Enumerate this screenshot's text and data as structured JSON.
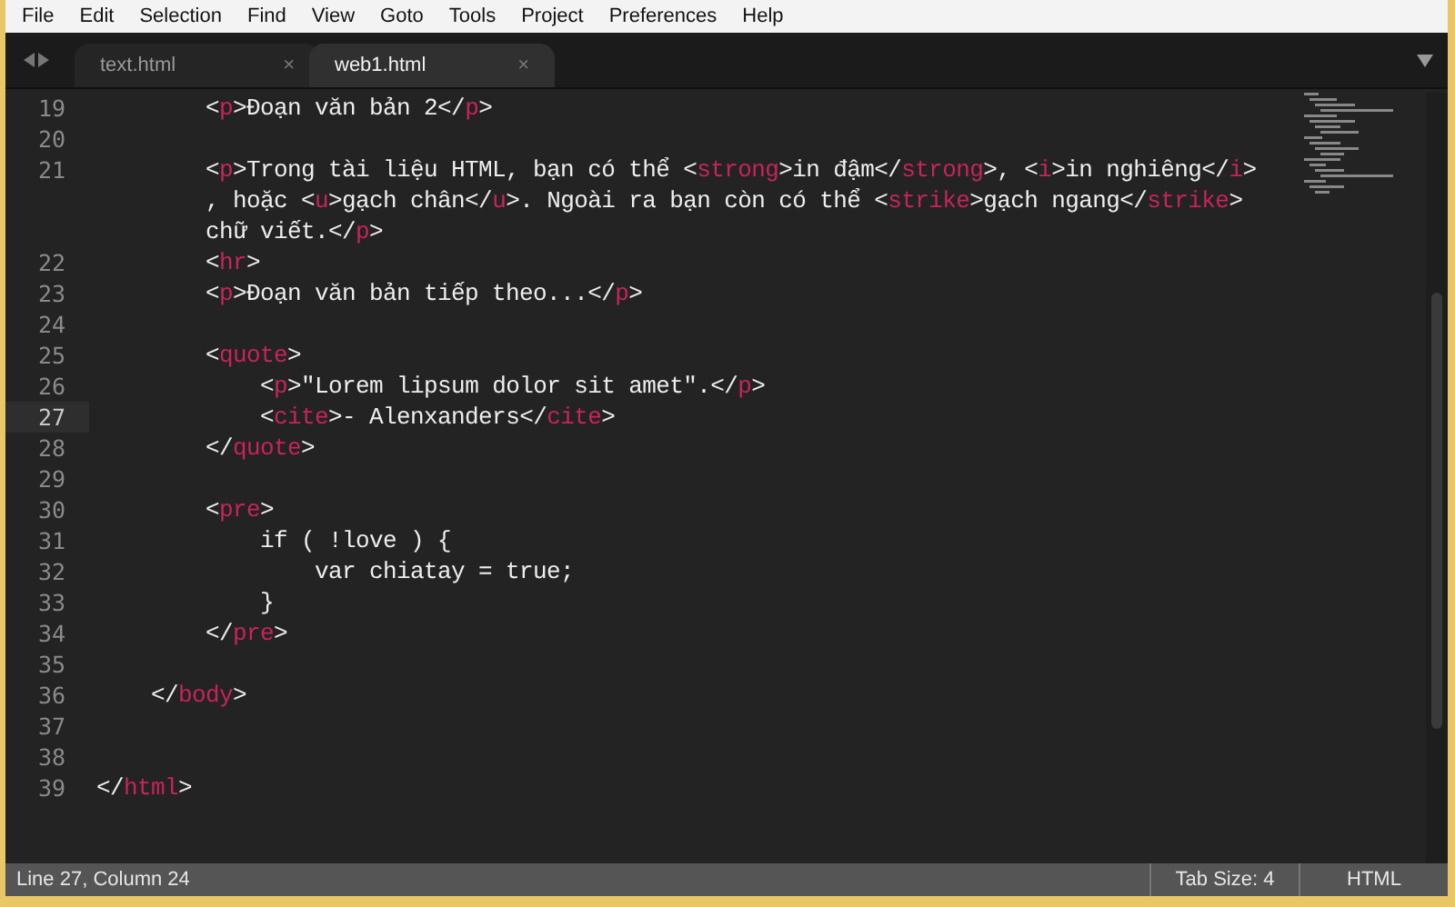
{
  "menu": [
    "File",
    "Edit",
    "Selection",
    "Find",
    "View",
    "Goto",
    "Tools",
    "Project",
    "Preferences",
    "Help"
  ],
  "tabs": [
    {
      "label": "text.html",
      "close": "×",
      "selected": false
    },
    {
      "label": "web1.html",
      "close": "×",
      "selected": true
    }
  ],
  "lines": [
    {
      "number": "19",
      "selected": false,
      "rows": [
        {
          "tokens": [
            {
              "kind": "text",
              "text": "        <"
            },
            {
              "kind": "tag",
              "text": "p"
            },
            {
              "kind": "text",
              "text": ">Đoạn văn bản 2</"
            },
            {
              "kind": "tag",
              "text": "p"
            },
            {
              "kind": "text",
              "text": ">"
            }
          ]
        }
      ]
    },
    {
      "number": "20",
      "selected": false
    },
    {
      "number": "21",
      "selected": false,
      "rows": [
        {
          "tokens": [
            {
              "kind": "text",
              "text": "        <"
            },
            {
              "kind": "tag",
              "text": "p"
            },
            {
              "kind": "text",
              "text": ">Trong tài liệu HTML, bạn có thể <"
            },
            {
              "kind": "tag",
              "text": "strong"
            },
            {
              "kind": "text",
              "text": ">in đậm</"
            },
            {
              "kind": "tag",
              "text": "strong"
            },
            {
              "kind": "text",
              "text": ">, <"
            },
            {
              "kind": "tag",
              "text": "i"
            },
            {
              "kind": "text",
              "text": ">in nghiêng</"
            },
            {
              "kind": "tag",
              "text": "i"
            },
            {
              "kind": "text",
              "text": ">"
            }
          ]
        },
        {
          "tokens": [
            {
              "kind": "text",
              "text": "        , hoặc <"
            },
            {
              "kind": "tag",
              "text": "u"
            },
            {
              "kind": "text",
              "text": ">gạch chân</"
            },
            {
              "kind": "tag",
              "text": "u"
            },
            {
              "kind": "text",
              "text": ">. Ngoài ra bạn còn có thể <"
            },
            {
              "kind": "tag",
              "text": "strike"
            },
            {
              "kind": "text",
              "text": ">gạch ngang</"
            },
            {
              "kind": "tag",
              "text": "strike"
            },
            {
              "kind": "text",
              "text": ">"
            }
          ]
        },
        {
          "tokens": [
            {
              "kind": "text",
              "text": "        chữ viết.</"
            },
            {
              "kind": "tag",
              "text": "p"
            },
            {
              "kind": "text",
              "text": ">"
            }
          ]
        }
      ]
    },
    {
      "number": "22",
      "selected": false,
      "rows": [
        {
          "tokens": [
            {
              "kind": "text",
              "text": "        <"
            },
            {
              "kind": "tag",
              "text": "hr"
            },
            {
              "kind": "text",
              "text": ">"
            }
          ]
        }
      ]
    },
    {
      "number": "23",
      "selected": false,
      "rows": [
        {
          "tokens": [
            {
              "kind": "text",
              "text": "        <"
            },
            {
              "kind": "tag",
              "text": "p"
            },
            {
              "kind": "text",
              "text": ">Đoạn văn bản tiếp theo...</"
            },
            {
              "kind": "tag",
              "text": "p"
            },
            {
              "kind": "text",
              "text": ">"
            }
          ]
        }
      ]
    },
    {
      "number": "24",
      "selected": false
    },
    {
      "number": "25",
      "selected": false,
      "rows": [
        {
          "tokens": [
            {
              "kind": "text",
              "text": "        <"
            },
            {
              "kind": "tag",
              "text": "quote"
            },
            {
              "kind": "text",
              "text": ">"
            }
          ]
        }
      ]
    },
    {
      "number": "26",
      "selected": false,
      "rows": [
        {
          "tokens": [
            {
              "kind": "text",
              "text": "            <"
            },
            {
              "kind": "tag",
              "text": "p"
            },
            {
              "kind": "text",
              "text": ">\"Lorem lipsum dolor sit amet\".</"
            },
            {
              "kind": "tag",
              "text": "p"
            },
            {
              "kind": "text",
              "text": ">"
            }
          ]
        }
      ]
    },
    {
      "number": "27",
      "selected": true,
      "rows": [
        {
          "tokens": [
            {
              "kind": "text",
              "text": "            <"
            },
            {
              "kind": "tag",
              "text": "cite"
            },
            {
              "kind": "text",
              "text": ">- Alenxanders</"
            },
            {
              "kind": "tag",
              "text": "cite"
            },
            {
              "kind": "text",
              "text": ">"
            }
          ]
        }
      ]
    },
    {
      "number": "28",
      "selected": false,
      "rows": [
        {
          "tokens": [
            {
              "kind": "text",
              "text": "        </"
            },
            {
              "kind": "tag",
              "text": "quote"
            },
            {
              "kind": "text",
              "text": ">"
            }
          ]
        }
      ]
    },
    {
      "number": "29",
      "selected": false
    },
    {
      "number": "30",
      "selected": false,
      "rows": [
        {
          "tokens": [
            {
              "kind": "text",
              "text": "        <"
            },
            {
              "kind": "tag",
              "text": "pre"
            },
            {
              "kind": "text",
              "text": ">"
            }
          ]
        }
      ]
    },
    {
      "number": "31",
      "selected": false,
      "rows": [
        {
          "tokens": [
            {
              "kind": "text",
              "text": "            if ( !love ) {"
            }
          ]
        }
      ]
    },
    {
      "number": "32",
      "selected": false,
      "rows": [
        {
          "tokens": [
            {
              "kind": "text",
              "text": "                var chiatay = true;"
            }
          ]
        }
      ]
    },
    {
      "number": "33",
      "selected": false,
      "rows": [
        {
          "tokens": [
            {
              "kind": "text",
              "text": "            }"
            }
          ]
        }
      ]
    },
    {
      "number": "34",
      "selected": false,
      "rows": [
        {
          "tokens": [
            {
              "kind": "text",
              "text": "        </"
            },
            {
              "kind": "tag",
              "text": "pre"
            },
            {
              "kind": "text",
              "text": ">"
            }
          ]
        }
      ]
    },
    {
      "number": "35",
      "selected": false
    },
    {
      "number": "36",
      "selected": false,
      "rows": [
        {
          "tokens": [
            {
              "kind": "text",
              "text": "    </"
            },
            {
              "kind": "tag",
              "text": "body"
            },
            {
              "kind": "text",
              "text": ">"
            }
          ]
        }
      ]
    },
    {
      "number": "37",
      "selected": false
    },
    {
      "number": "38",
      "selected": false
    },
    {
      "number": "39",
      "selected": false,
      "rows": [
        {
          "tokens": [
            {
              "kind": "text",
              "text": "</"
            },
            {
              "kind": "tag",
              "text": "html"
            },
            {
              "kind": "text",
              "text": ">"
            }
          ]
        }
      ]
    }
  ],
  "status_bar": {
    "position": "Line 27, Column 24",
    "tab_size": "Tab Size: 4",
    "syntax": "HTML"
  }
}
